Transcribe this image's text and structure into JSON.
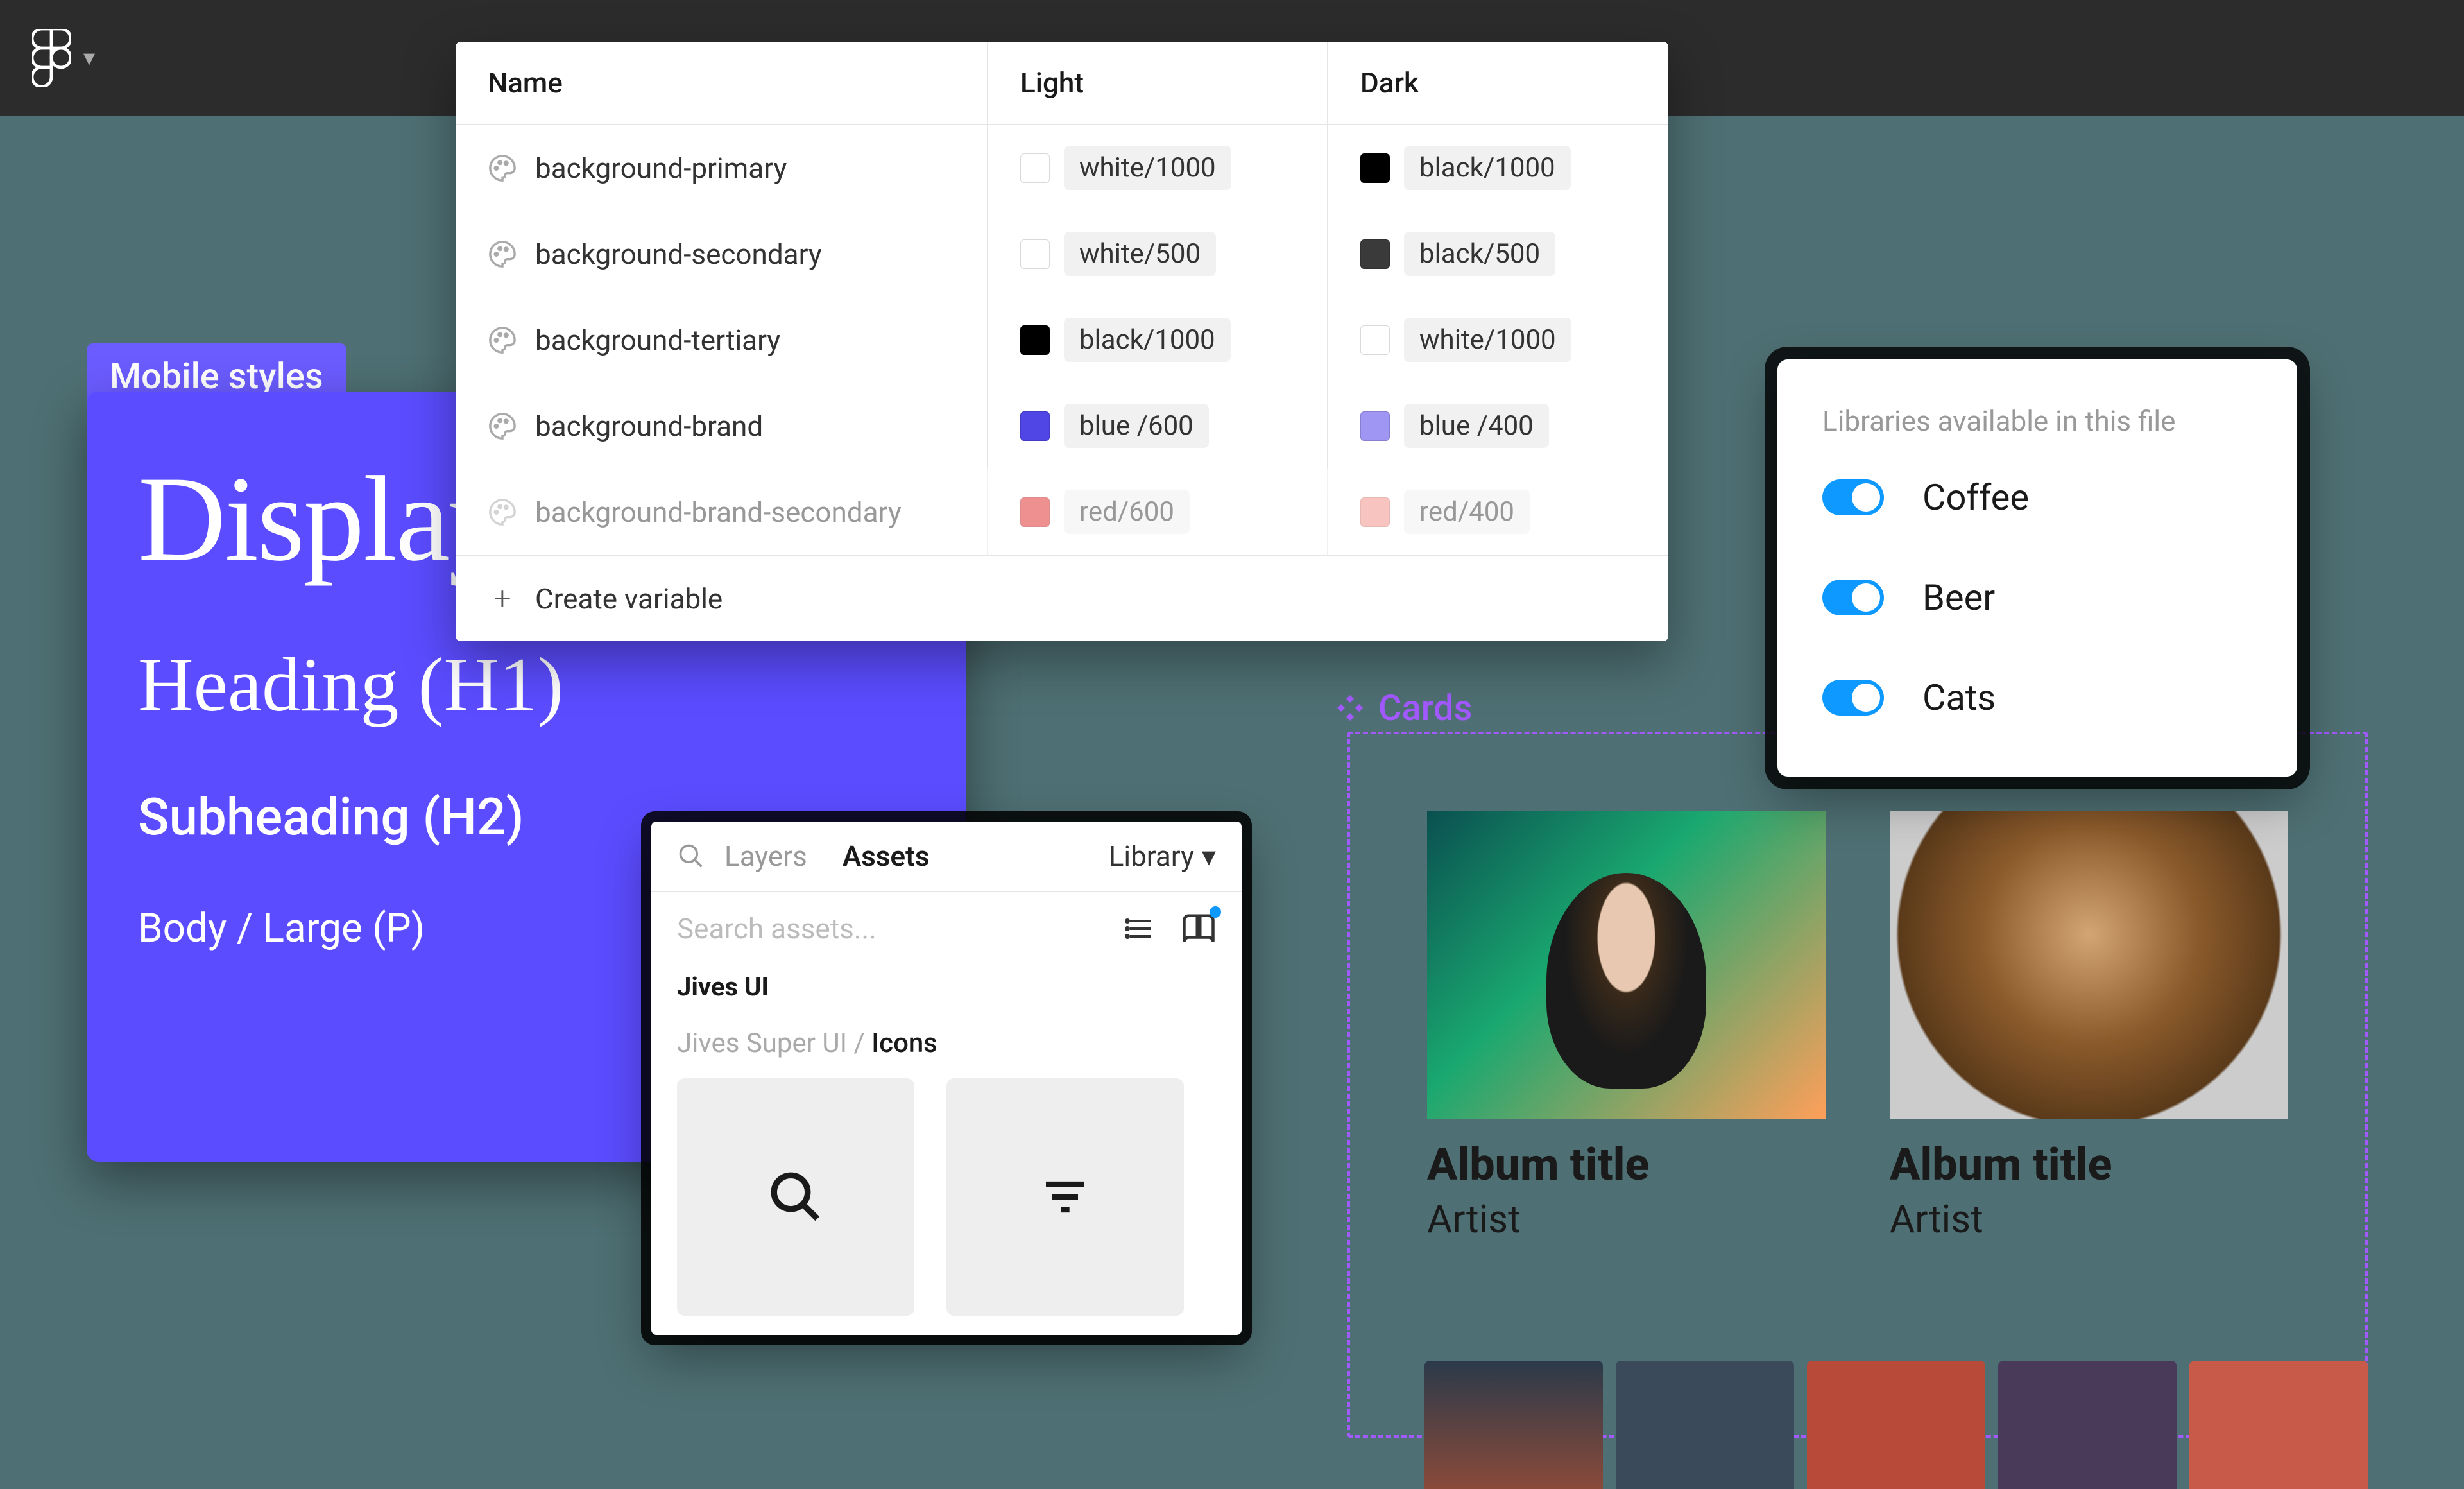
{
  "titlebar": {
    "app": "Figma"
  },
  "mobileStyles": {
    "label": "Mobile styles",
    "display": "Display",
    "h1": "Heading (H1)",
    "h2": "Subheading (H2)",
    "body": "Body / Large (P)"
  },
  "variables": {
    "columns": {
      "name": "Name",
      "light": "Light",
      "dark": "Dark"
    },
    "rows": [
      {
        "name": "background-primary",
        "light": {
          "color": "#ffffff",
          "label": "white/1000"
        },
        "dark": {
          "color": "#000000",
          "label": "black/1000"
        }
      },
      {
        "name": "background-secondary",
        "light": {
          "color": "#ffffff",
          "label": "white/500"
        },
        "dark": {
          "color": "#3a3a3a",
          "label": "black/500"
        }
      },
      {
        "name": "background-tertiary",
        "light": {
          "color": "#000000",
          "label": "black/1000"
        },
        "dark": {
          "color": "#ffffff",
          "label": "white/1000"
        }
      },
      {
        "name": "background-brand",
        "light": {
          "color": "#4f46e5",
          "label": "blue /600"
        },
        "dark": {
          "color": "#9e96f2",
          "label": "blue /400"
        }
      },
      {
        "name": "background-brand-secondary",
        "light": {
          "color": "#e02424",
          "label": "red/600"
        },
        "dark": {
          "color": "#f28b82",
          "label": "red/400"
        },
        "faded": true
      }
    ],
    "createLabel": "Create variable"
  },
  "libraries": {
    "title": "Libraries available in this file",
    "items": [
      {
        "name": "Coffee",
        "enabled": true
      },
      {
        "name": "Beer",
        "enabled": true
      },
      {
        "name": "Cats",
        "enabled": true
      }
    ]
  },
  "assets": {
    "tabs": {
      "layers": "Layers",
      "assets": "Assets",
      "library": "Library"
    },
    "searchPlaceholder": "Search assets...",
    "section": "Jives UI",
    "breadcrumbParent": "Jives Super UI / ",
    "breadcrumbCurrent": "Icons"
  },
  "cards": {
    "label": "Cards",
    "items": [
      {
        "title": "Album title",
        "artist": "Artist"
      },
      {
        "title": "Album title",
        "artist": "Artist"
      }
    ]
  }
}
